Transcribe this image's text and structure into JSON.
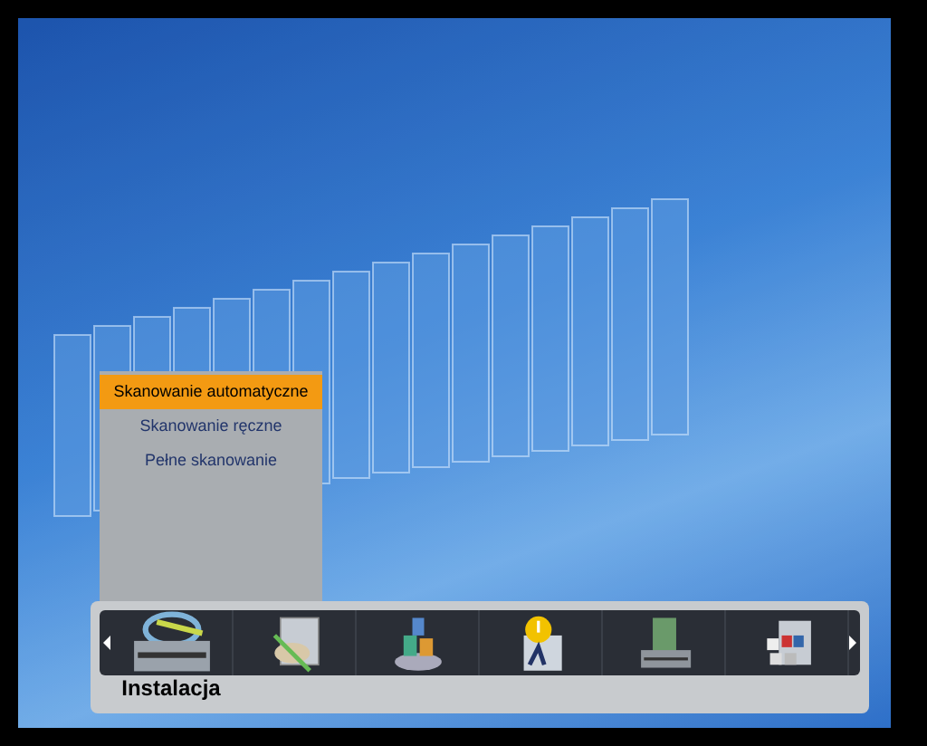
{
  "scan_menu": {
    "items": [
      {
        "label": "Skanowanie automatyczne",
        "selected": true
      },
      {
        "label": "Skanowanie ręczne",
        "selected": false
      },
      {
        "label": "Pełne skanowanie",
        "selected": false
      }
    ]
  },
  "main_menu": {
    "items": [
      {
        "label": "Instalacja",
        "selected": true
      },
      {
        "selected": false
      },
      {
        "selected": false
      },
      {
        "selected": false
      },
      {
        "selected": false
      },
      {
        "selected": false
      }
    ]
  }
}
